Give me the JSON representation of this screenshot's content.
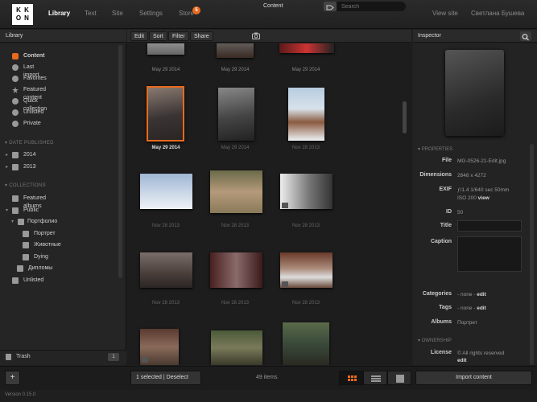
{
  "logo": {
    "letters": [
      "K",
      "K",
      "O",
      "N"
    ]
  },
  "nav": {
    "library": "Library",
    "text": "Text",
    "site": "Site",
    "settings": "Settings",
    "store": "Store",
    "store_badge": "5"
  },
  "topright": {
    "view_site": "View site",
    "user": "Светлана Бушева"
  },
  "library": {
    "header": "Library",
    "items": [
      {
        "label": "Content",
        "icon": "camera-icon",
        "active": true
      },
      {
        "label": "Last import",
        "icon": "clock-icon"
      },
      {
        "label": "Favorites",
        "icon": "heart-icon"
      },
      {
        "label": "Featured content",
        "icon": "star-icon"
      },
      {
        "label": "Quick collection",
        "icon": "lightning-icon"
      },
      {
        "label": "Unlisted",
        "icon": "link-icon"
      },
      {
        "label": "Private",
        "icon": "private-icon"
      }
    ],
    "date_published": "DATE PUBLISHED",
    "years": [
      "2014",
      "2013"
    ],
    "collections": "COLLECTIONS",
    "collection_items": [
      "Featured albums",
      "Public",
      "Портфолио",
      "Портрет",
      "Животные",
      "Dying",
      "Дипломы",
      "Unlisted"
    ],
    "trash": "Trash",
    "trash_count": "1",
    "version": "Version 0.15.0"
  },
  "toolbar": {
    "edit": "Edit",
    "sort": "Sort",
    "filter": "Filter",
    "share": "Share",
    "title": "Content",
    "search_placeholder": "Search"
  },
  "grid": {
    "captions": [
      [
        "May 29 2014",
        "May 29 2014",
        "May 29 2014"
      ],
      [
        "May 29 2014",
        "May 29 2014",
        "Nov 28 2013"
      ],
      [
        "Nov 28 2013",
        "Nov 28 2013",
        "Nov 28 2013"
      ],
      [
        "Nov 28 2013",
        "Nov 28 2013",
        "Nov 28 2013"
      ]
    ]
  },
  "bottom": {
    "selected": "1",
    "selected_label": "selected",
    "deselect": "Deselect",
    "items": "49 items",
    "import": "Import content"
  },
  "inspector": {
    "header": "Inspector",
    "properties": "PROPERTIES",
    "file_label": "File",
    "file": "MG-0526-21-Edit.jpg",
    "dims_label": "Dimensions",
    "dims": "2848 x 4272",
    "exif_label": "EXIF",
    "exif1": "ƒ/1.4  1/640 sec  50mm",
    "exif2": "ISO 200",
    "exif_view": "view",
    "id_label": "ID",
    "id": "50",
    "title_label": "Title",
    "caption_label": "Caption",
    "categories_label": "Categories",
    "none": "- none -",
    "edit": "edit",
    "tags_label": "Tags",
    "albums_label": "Albums",
    "albums": "Портрет",
    "ownership": "OWNERSHIP",
    "license_label": "License",
    "license": "© All rights reserved"
  },
  "colors": {
    "accent": "#e86a1e",
    "bg": "#1f1f1f"
  }
}
